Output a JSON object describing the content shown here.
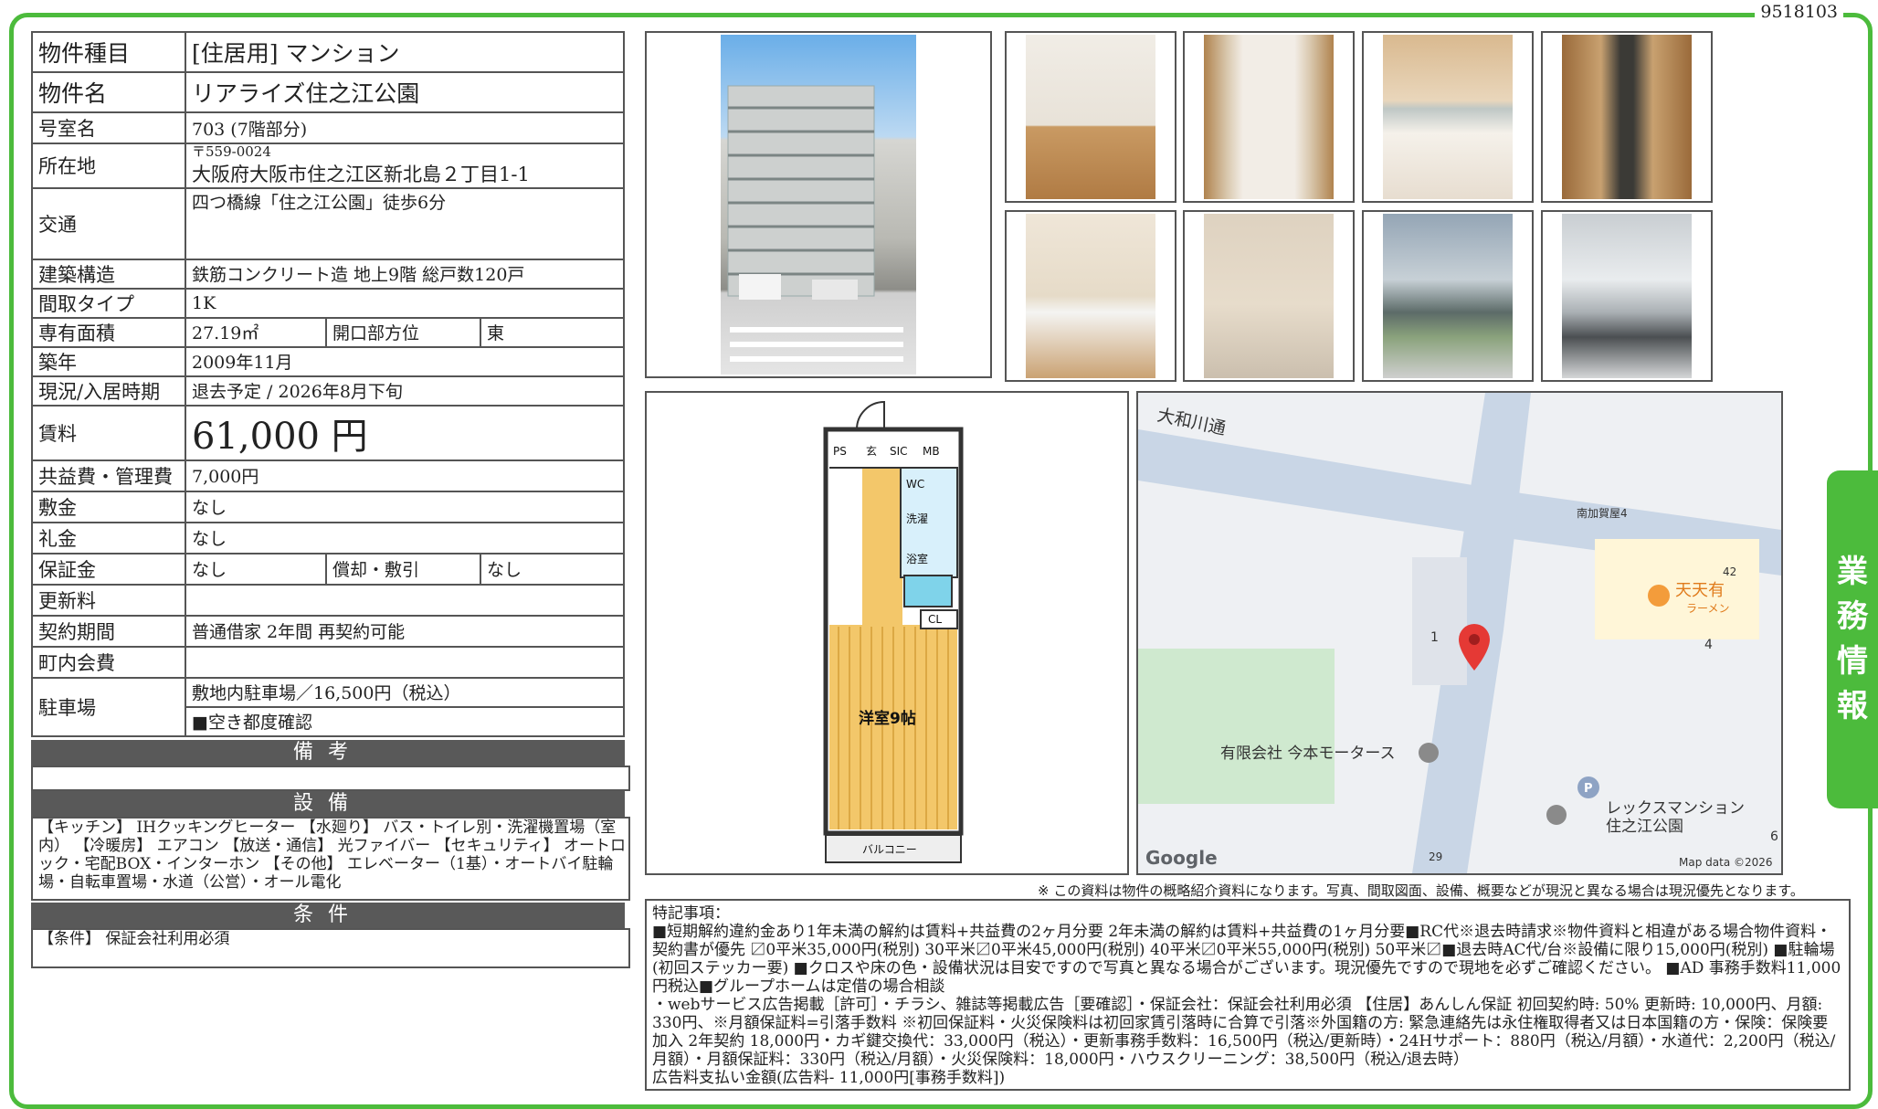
{
  "doc_id": "9518103",
  "side_tab": [
    "業",
    "務",
    "情",
    "報"
  ],
  "property": {
    "type_label": "物件種目",
    "type": "[住居用] マンション",
    "name_label": "物件名",
    "name": "リアライズ住之江公園",
    "room_label": "号室名",
    "room": "703 (7階部分)",
    "address_label": "所在地",
    "postal": "〒559-0024",
    "address": "大阪府大阪市住之江区新北島２丁目1-1",
    "access_label": "交通",
    "access": "四つ橋線「住之江公園」徒歩6分",
    "structure_label": "建築構造",
    "structure": "鉄筋コンクリート造 地上9階 総戸数120戸",
    "layout_label": "間取タイプ",
    "layout": "1K",
    "area_label": "専有面積",
    "area": "27.19㎡",
    "direction_label": "開口部方位",
    "direction": "東",
    "built_label": "築年",
    "built": "2009年11月",
    "status_label": "現況/入居時期",
    "status": "退去予定 / 2026年8月下旬",
    "rent_label": "賃料",
    "rent": "61,000 円",
    "fee_label": "共益費・管理費",
    "fee": "7,000円",
    "deposit_label": "敷金",
    "deposit": "なし",
    "key_money_label": "礼金",
    "key_money": "なし",
    "guarantee_label": "保証金",
    "guarantee": "なし",
    "amort_label": "償却・敷引",
    "amort": "なし",
    "renewal_label": "更新料",
    "renewal": "",
    "contract_label": "契約期間",
    "contract": "普通借家 2年間 再契約可能",
    "community_label": "町内会費",
    "community": "",
    "parking_label": "駐車場",
    "parking": "敷地内駐車場／16,500円（税込）",
    "parking_note": "■空き都度確認"
  },
  "sections": {
    "remarks_title": "備考",
    "equipment_title": "設備",
    "equipment_text": "【キッチン】 IHクッキングヒーター 【水廻り】 バス・トイレ別・洗濯機置場（室内） 【冷暖房】 エアコン 【放送・通信】 光ファイバー 【セキュリティ】 オートロック・宅配BOX・インターホン 【その他】 エレベーター（1基）・オートバイ駐輪場・自転車置場・水道（公営）・オール電化",
    "conditions_title": "条件",
    "conditions_text": "【条件】 保証会社利用必須"
  },
  "floorplan": {
    "labels": [
      "PS",
      "玄",
      "SIC",
      "MB",
      "WC",
      "洗濯",
      "浴室",
      "CL",
      "洋室9帖",
      "バルコニー"
    ]
  },
  "map": {
    "road": "大和川通",
    "stop": "南加賀屋4",
    "restaurant": "天天有",
    "restaurant_sub": "ラーメン",
    "company": "有限会社 今本モータース",
    "mansion": "レックスマンション",
    "mansion_sub": "住之江公園",
    "route_42": "42",
    "route_29": "29",
    "num_1": "1",
    "num_4": "4",
    "num_6": "6",
    "parking": "P",
    "google": "Google",
    "mapdata": "Map data ©2026"
  },
  "note": "※ この資料は物件の概略紹介資料になります。写真、間取図面、設備、概要などが現況と異なる場合は現況優先となります。",
  "special": {
    "title": "特記事項：",
    "line1": "■短期解約違約金あり1年未満の解約は賃料+共益費の2ヶ月分要 2年未満の解約は賃料+共益費の1ヶ月分要■RC代※退去時請求※物件資料と相違がある場合物件資料・契約書が優先 〼0平米35,000円(税別) 30平米〼0平米45,000円(税別) 40平米〼0平米55,000円(税別) 50平米〼■退去時AC代/台※設備に限り15,000円(税別) ■駐輪場(初回ステッカー要) ■クロスや床の色・設備状況は目安ですので写真と異なる場合がございます。現況優先ですので現地を必ずご確認ください。 ■AD 事務手数料11,000円税込■グループホームは定借の場合相談",
    "line2": "・webサービス広告掲載［許可］・チラシ、雑誌等掲載広告［要確認］・保証会社：保証会社利用必須 【住居】あんしん保証 初回契約時: 50% 更新時: 10,000円、月額: 330円、※月額保証料=引落手数料 ※初回保証料・火災保険料は初回家賃引落時に合算で引落※外国籍の方: 緊急連絡先は永住権取得者又は日本国籍の方・保険：保険要加入 2年契約 18,000円・カギ鍵交換代：33,000円（税込）・更新事務手数料：16,500円（税込/更新時）・24Hサポート：880円（税込/月額）・水道代：2,200円（税込/月額）・月額保証料：330円（税込/月額）・火災保険料：18,000円・ハウスクリーニング：38,500円（税込/退去時）",
    "line3": "広告料支払い金額(広告料- 11,000円[事務手数料])"
  },
  "colors": {
    "accent": "#4cbb3c",
    "header_bar": "#595959"
  }
}
